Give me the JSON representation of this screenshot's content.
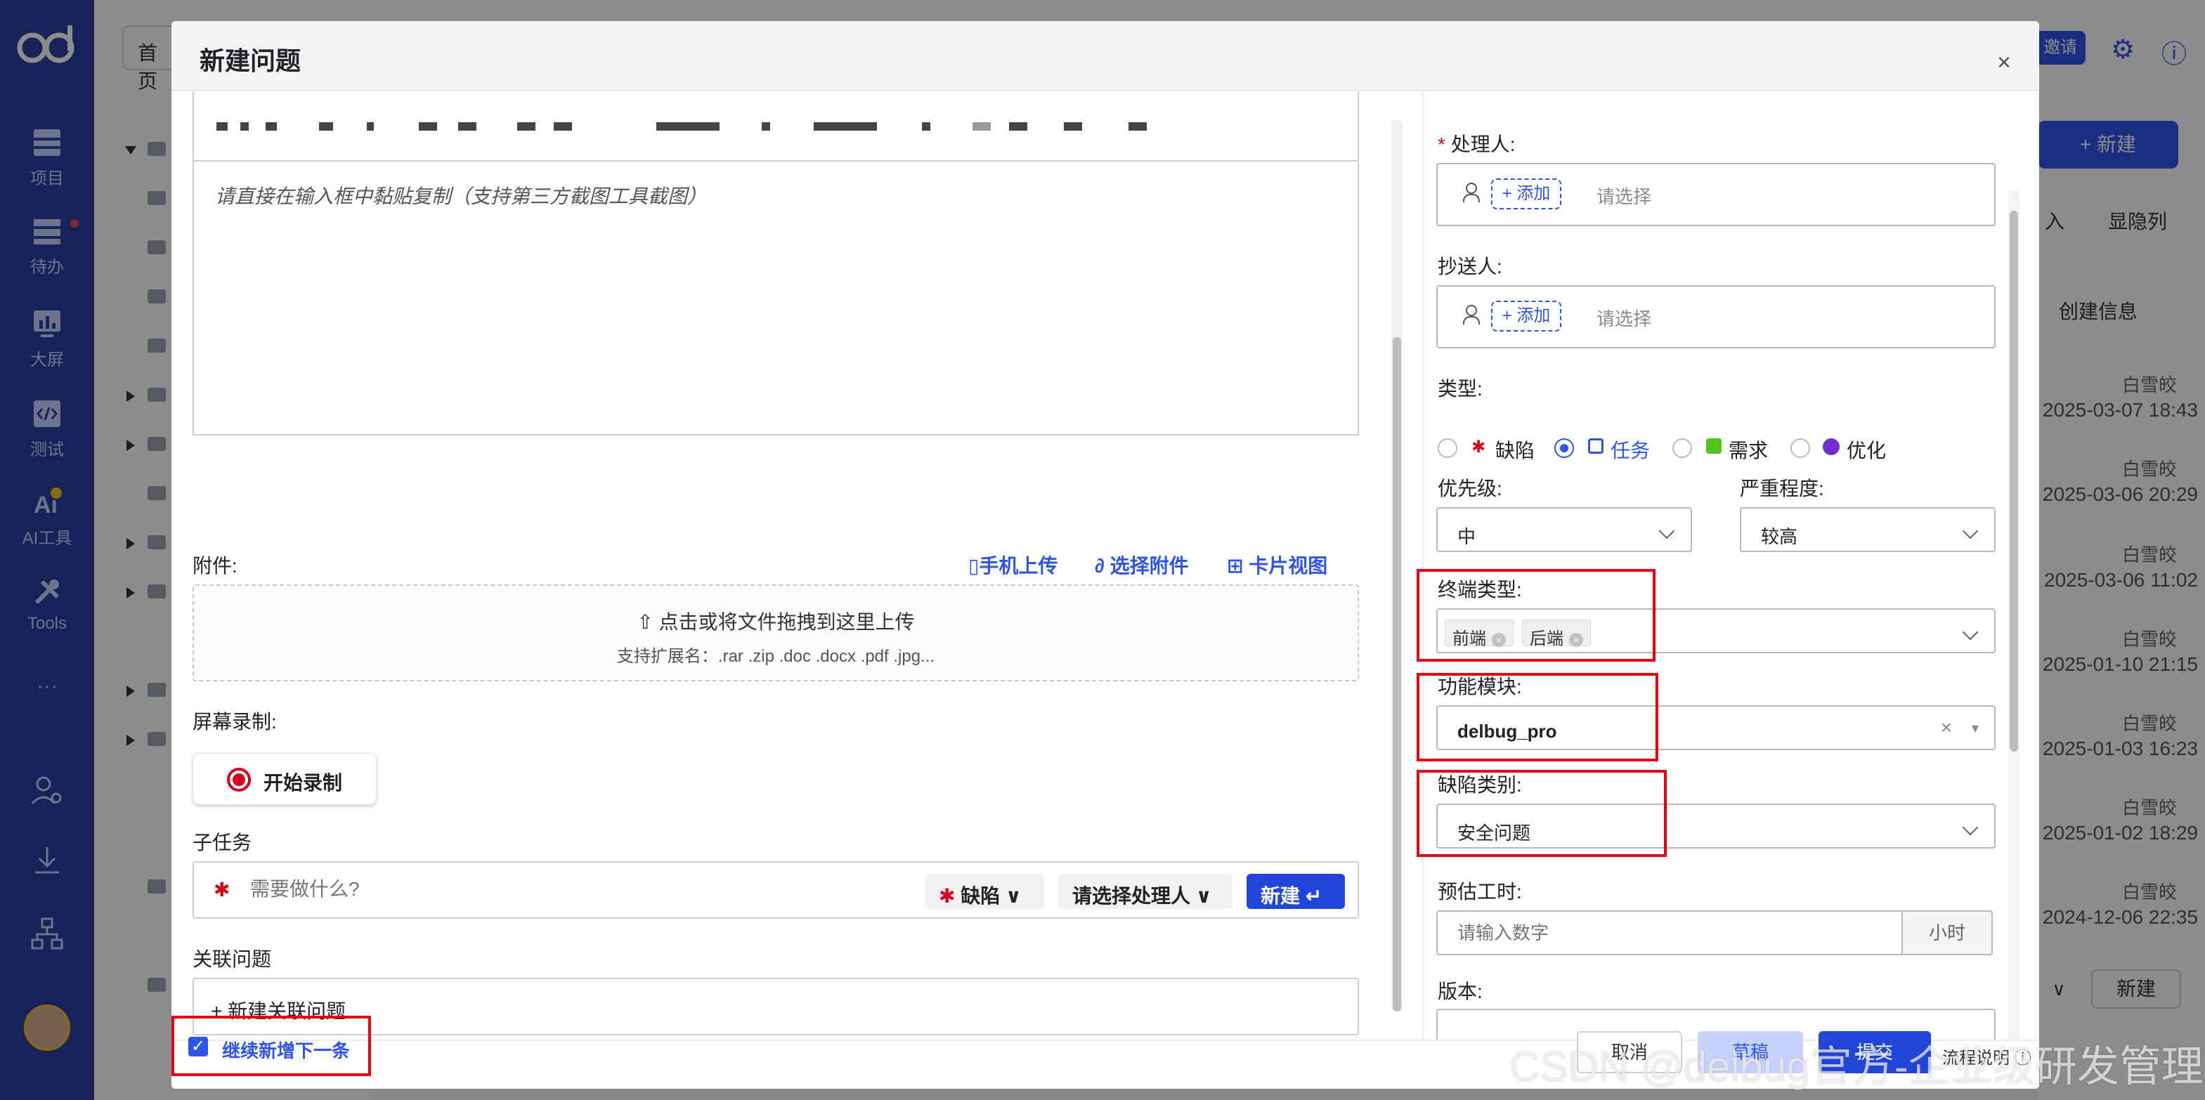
{
  "sidebar": {
    "items": [
      {
        "label": "项目",
        "icon": "project-icon"
      },
      {
        "label": "待办",
        "icon": "todo-icon"
      },
      {
        "label": "大屏",
        "icon": "dashboard-icon"
      },
      {
        "label": "测试",
        "icon": "test-icon"
      },
      {
        "label": "AI工具",
        "icon": "ai-icon"
      },
      {
        "label": "Tools",
        "icon": "tools-icon"
      },
      {
        "label": "···",
        "icon": "more-icon"
      }
    ]
  },
  "background": {
    "home_tab": "首页",
    "invite_label": "邀请",
    "new_button": "+ 新建",
    "tool_import": "入",
    "tool_columns": "显隐列",
    "col_header": "创建信息",
    "rows": [
      {
        "who": "白雪皎",
        "when": "2025-03-07 18:43"
      },
      {
        "who": "白雪皎",
        "when": "2025-03-06 20:29"
      },
      {
        "who": "白雪皎",
        "when": "2025-03-06 11:02"
      },
      {
        "who": "白雪皎",
        "when": "2025-01-10 21:15"
      },
      {
        "who": "白雪皎",
        "when": "2025-01-03 16:23"
      },
      {
        "who": "白雪皎",
        "when": "2025-01-02 18:29"
      },
      {
        "who": "白雪皎",
        "when": "2024-12-06 22:35"
      }
    ],
    "bottom_new": "新建"
  },
  "modal": {
    "title": "新建问题",
    "close": "×",
    "editor": {
      "placeholder": "请直接在输入框中黏贴复制（支持第三方截图工具截图）"
    },
    "attachments": {
      "label": "附件:",
      "phone_upload": "手机上传",
      "choose_file": "选择附件",
      "card_view": "卡片视图",
      "drop_text": "点击或将文件拖拽到这里上传",
      "hint": "支持扩展名：.rar .zip .doc .docx .pdf .jpg..."
    },
    "recording": {
      "label": "屏幕录制:",
      "start": "开始录制"
    },
    "subtask": {
      "label": "子任务",
      "placeholder": "需要做什么?",
      "type": "缺陷",
      "assignee": "请选择处理人",
      "new": "新建"
    },
    "related": {
      "label": "关联问题",
      "new": "+ 新建关联问题"
    },
    "footer": {
      "continue": "继续新增下一条",
      "cancel": "取消",
      "draft": "草稿",
      "submit": "提交",
      "flow": "流程说明"
    },
    "form": {
      "assignee_label": "处理人:",
      "cc_label": "抄送人:",
      "add": "+ 添加",
      "select_placeholder": "请选择",
      "type_label": "类型:",
      "types": [
        {
          "label": "缺陷",
          "selected": false,
          "color": "#d9001b"
        },
        {
          "label": "任务",
          "selected": true,
          "color": "#2f54eb"
        },
        {
          "label": "需求",
          "selected": false,
          "color": "#52c41a"
        },
        {
          "label": "优化",
          "selected": false,
          "color": "#722ed1"
        }
      ],
      "priority_label": "优先级:",
      "priority": "中",
      "severity_label": "严重程度:",
      "severity": "较高",
      "terminal_label": "终端类型:",
      "terminal_tags": [
        "前端",
        "后端"
      ],
      "module_label": "功能模块:",
      "module": "delbug_pro",
      "defect_cat_label": "缺陷类别:",
      "defect_cat": "安全问题",
      "estimate_label": "预估工时:",
      "estimate_placeholder": "请输入数字",
      "estimate_unit": "小时",
      "version_label": "版本:"
    }
  },
  "watermark": "CSDN @delbug官方-企业级研发管理",
  "colors": {
    "nav_bg": "#2d3fa5",
    "accent": "#2f54eb",
    "highlight_border": "#e60012"
  }
}
